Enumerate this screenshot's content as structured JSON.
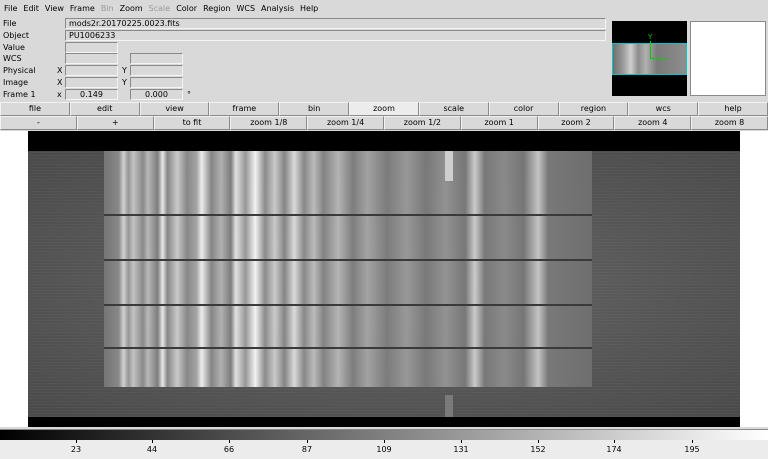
{
  "menu": [
    "File",
    "Edit",
    "View",
    "Frame",
    "Bin",
    "Zoom",
    "Scale",
    "Color",
    "Region",
    "WCS",
    "Analysis",
    "Help"
  ],
  "menu_disabled": [
    "Bin",
    "Scale"
  ],
  "info": {
    "file_label": "File",
    "file_value": "mods2r.20170225.0023.fits",
    "object_label": "Object",
    "object_value": "PU1006233",
    "value_label": "Value",
    "wcs_label": "WCS",
    "physical_label": "Physical",
    "image_label": "Image",
    "frame_label": "Frame 1",
    "x_label": "X",
    "y_label": "Y",
    "frame_x_label": "x",
    "zoom_value": "0.149",
    "angle_value": "0.000",
    "degree_symbol": "°"
  },
  "main_buttons": [
    "file",
    "edit",
    "view",
    "frame",
    "bin",
    "zoom",
    "scale",
    "color",
    "region",
    "wcs",
    "help"
  ],
  "active_main_button": "zoom",
  "zoom_buttons": [
    "-",
    "+",
    "to fit",
    "zoom 1/8",
    "zoom 1/4",
    "zoom 1/2",
    "zoom 1",
    "zoom 2",
    "zoom 4",
    "zoom 8"
  ],
  "panner": {
    "y_axis_label": "Y"
  },
  "colorbar": {
    "ticks": [
      "23",
      "44",
      "66",
      "87",
      "109",
      "131",
      "152",
      "174",
      "195"
    ],
    "tick_positions_frac": [
      0.099,
      0.198,
      0.298,
      0.4,
      0.5,
      0.6,
      0.701,
      0.8,
      0.901
    ]
  }
}
